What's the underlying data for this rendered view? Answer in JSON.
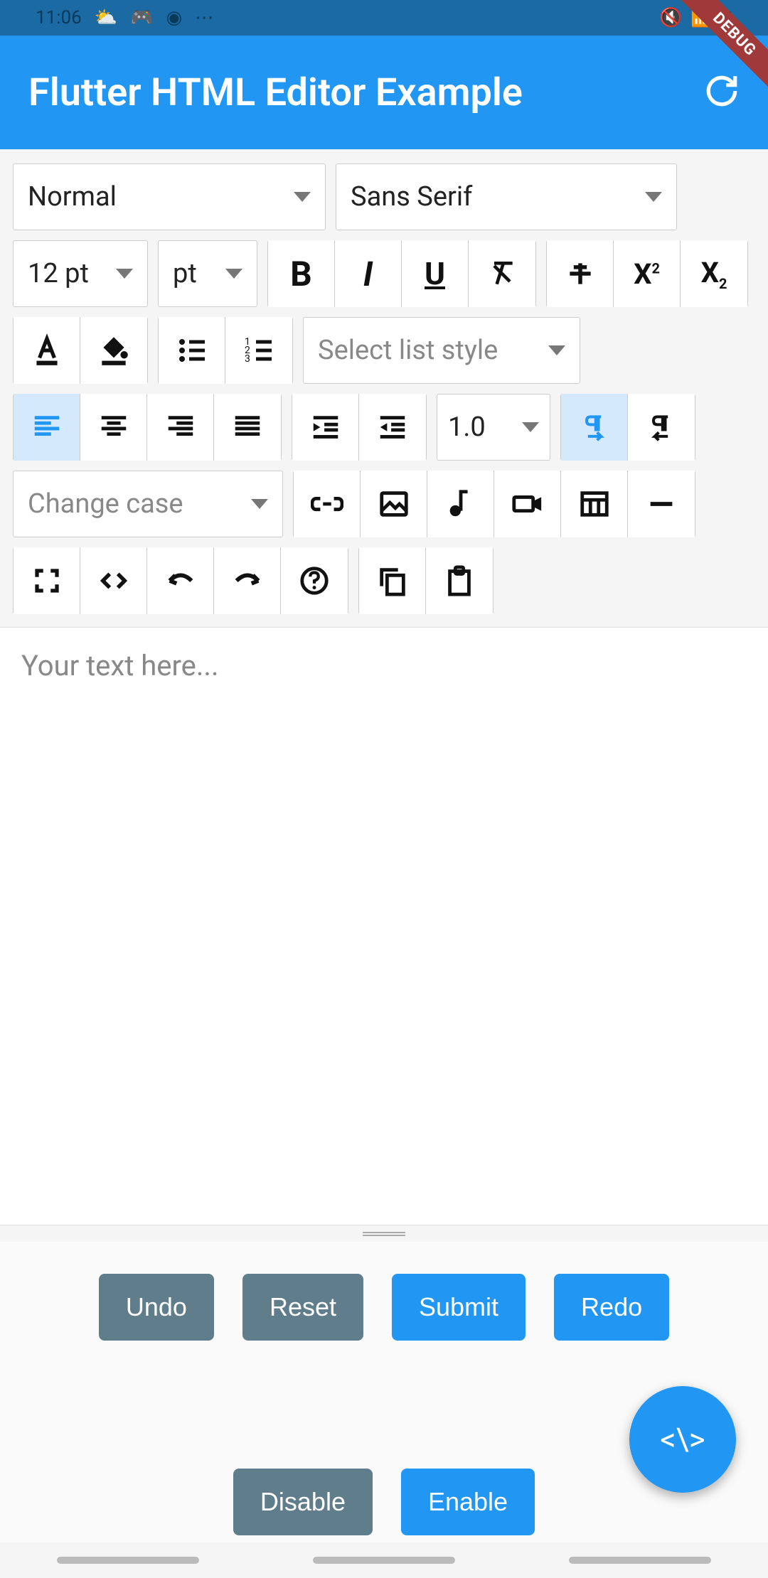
{
  "status": {
    "time": "11:06"
  },
  "app": {
    "title": "Flutter HTML Editor Example"
  },
  "debug_banner": "DEBUG",
  "toolbar": {
    "paragraph_style": "Normal",
    "font_family": "Sans Serif",
    "font_size": "12 pt",
    "font_unit": "pt",
    "list_style_placeholder": "Select list style",
    "line_height": "1.0",
    "change_case_placeholder": "Change case"
  },
  "editor": {
    "placeholder": "Your text here..."
  },
  "buttons": {
    "undo": "Undo",
    "reset": "Reset",
    "submit": "Submit",
    "redo": "Redo",
    "disable": "Disable",
    "enable": "Enable"
  },
  "fab": "<\\>",
  "colors": {
    "primary": "#2196f3",
    "grey_button": "#607d8b",
    "status_bar": "#1b6aa3"
  }
}
